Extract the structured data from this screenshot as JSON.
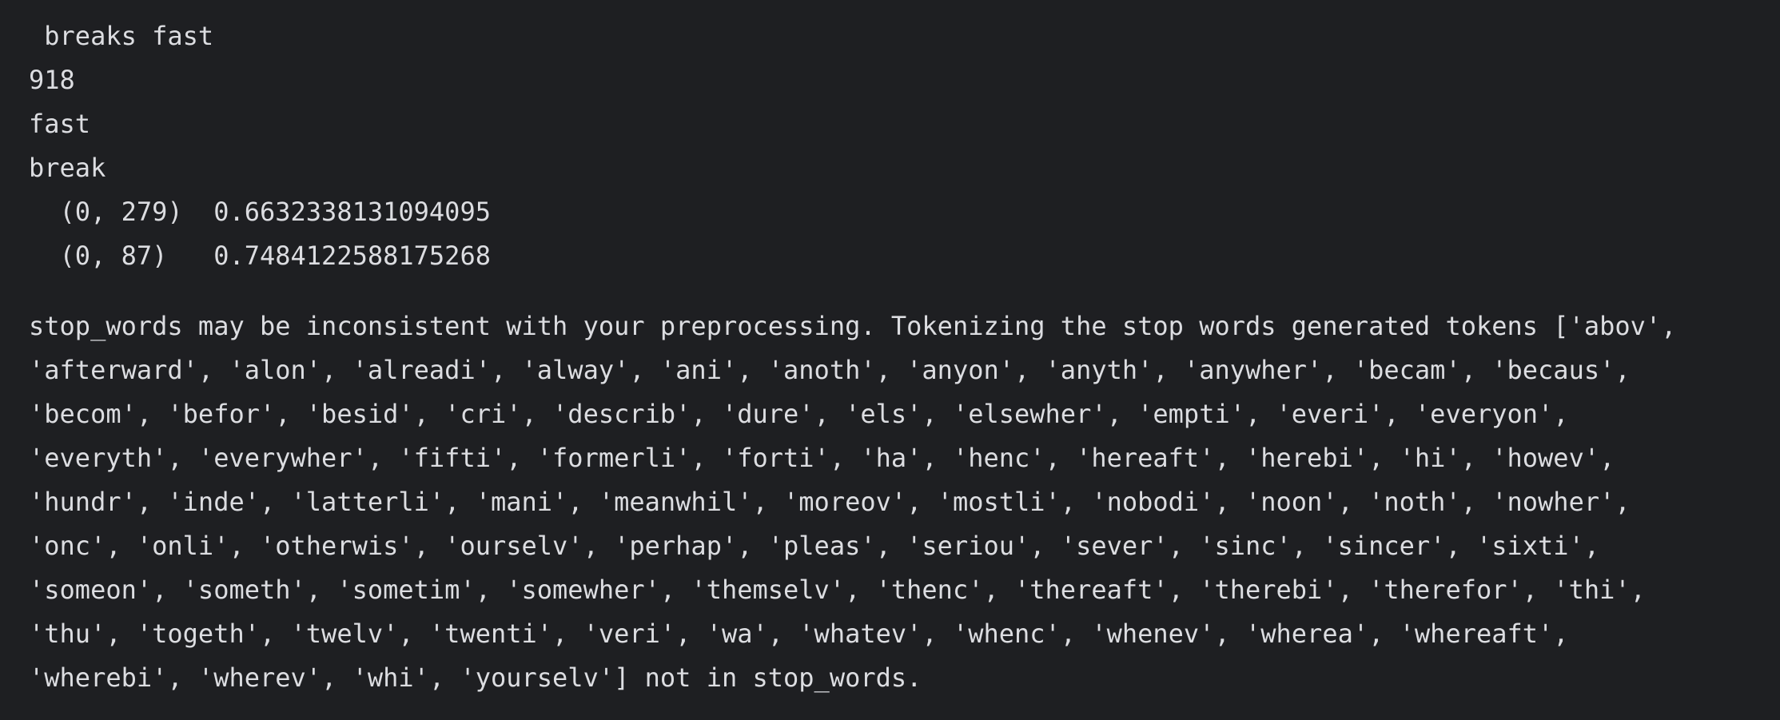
{
  "output_lines": [
    " breaks fast",
    "918",
    "fast",
    "break",
    "  (0, 279)  0.6632338131094095",
    "  (0, 87)   0.7484122588175268"
  ],
  "warning_lines": [
    "stop_words may be inconsistent with your preprocessing. Tokenizing the stop words generated tokens ['abov',",
    "'afterward', 'alon', 'alreadi', 'alway', 'ani', 'anoth', 'anyon', 'anyth', 'anywher', 'becam', 'becaus',",
    "'becom', 'befor', 'besid', 'cri', 'describ', 'dure', 'els', 'elsewher', 'empti', 'everi', 'everyon',",
    "'everyth', 'everywher', 'fifti', 'formerli', 'forti', 'ha', 'henc', 'hereaft', 'herebi', 'hi', 'howev',",
    "'hundr', 'inde', 'latterli', 'mani', 'meanwhil', 'moreov', 'mostli', 'nobodi', 'noon', 'noth', 'nowher',",
    "'onc', 'onli', 'otherwis', 'ourselv', 'perhap', 'pleas', 'seriou', 'sever', 'sinc', 'sincer', 'sixti',",
    "'someon', 'someth', 'sometim', 'somewher', 'themselv', 'thenc', 'thereaft', 'therebi', 'therefor', 'thi',",
    "'thu', 'togeth', 'twelv', 'twenti', 'veri', 'wa', 'whatev', 'whenc', 'whenev', 'wherea', 'whereaft',",
    "'wherebi', 'wherev', 'whi', 'yourselv'] not in stop_words."
  ]
}
